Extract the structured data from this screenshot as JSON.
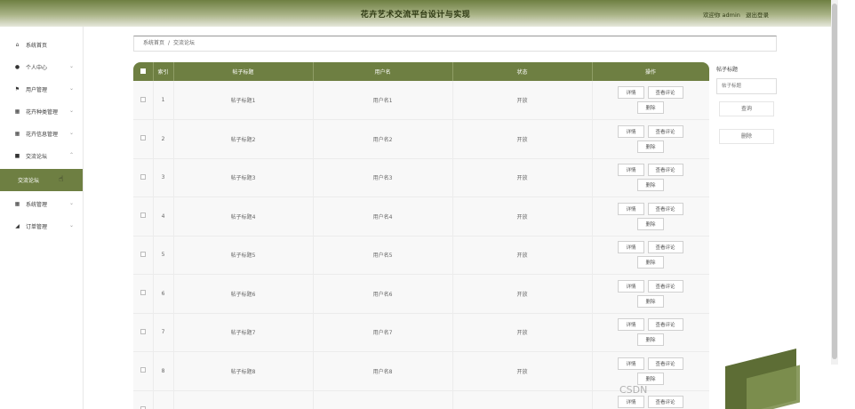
{
  "header": {
    "title": "花卉艺术交流平台设计与实现",
    "user_label": "欢迎你 admin",
    "logout_label": "退出登录"
  },
  "sidebar": {
    "items": [
      {
        "label": "系统首页",
        "icon": "home-icon",
        "glyph": "⌂",
        "has_chevron": false
      },
      {
        "label": "个人中心",
        "icon": "person-icon",
        "glyph": "●",
        "has_chevron": true
      },
      {
        "label": "用户管理",
        "icon": "flag-icon",
        "glyph": "⚑",
        "has_chevron": true
      },
      {
        "label": "花卉种类管理",
        "icon": "grid-icon",
        "glyph": "▦",
        "has_chevron": true
      },
      {
        "label": "花卉信息管理",
        "icon": "grid-icon",
        "glyph": "▦",
        "has_chevron": true
      },
      {
        "label": "交流论坛",
        "icon": "forum-icon",
        "glyph": "■",
        "has_chevron": true,
        "chevron_up": true
      },
      {
        "label": "交流论坛",
        "icon": "",
        "glyph": "",
        "has_chevron": false,
        "active": true
      },
      {
        "label": "系统管理",
        "icon": "grid-icon",
        "glyph": "▦",
        "has_chevron": true
      },
      {
        "label": "订单管理",
        "icon": "cart-icon",
        "glyph": "◢",
        "has_chevron": true
      }
    ]
  },
  "breadcrumb": {
    "home": "系统首页",
    "separator": "/",
    "current": "交流论坛"
  },
  "table": {
    "columns": [
      "",
      "索引",
      "帖子标题",
      "用户名",
      "状态",
      "操作"
    ],
    "rows": [
      {
        "index": "1",
        "title": "帖子标题1",
        "user": "用户名1",
        "status": "开放"
      },
      {
        "index": "2",
        "title": "帖子标题2",
        "user": "用户名2",
        "status": "开放"
      },
      {
        "index": "3",
        "title": "帖子标题3",
        "user": "用户名3",
        "status": "开放"
      },
      {
        "index": "4",
        "title": "帖子标题4",
        "user": "用户名4",
        "status": "开放"
      },
      {
        "index": "5",
        "title": "帖子标题5",
        "user": "用户名5",
        "status": "开放"
      },
      {
        "index": "6",
        "title": "帖子标题6",
        "user": "用户名6",
        "status": "开放"
      },
      {
        "index": "7",
        "title": "帖子标题7",
        "user": "用户名7",
        "status": "开放"
      },
      {
        "index": "8",
        "title": "帖子标题8",
        "user": "用户名8",
        "status": "开放"
      },
      {
        "index": "",
        "title": "",
        "user": "",
        "status": ""
      }
    ],
    "op_detail": "详情",
    "op_comment": "查看评论",
    "op_delete": "删除"
  },
  "search": {
    "label": "帖子标题",
    "placeholder": "帖子标题",
    "search_button": "查询",
    "delete_button": "删除"
  },
  "watermark": "CSDN"
}
